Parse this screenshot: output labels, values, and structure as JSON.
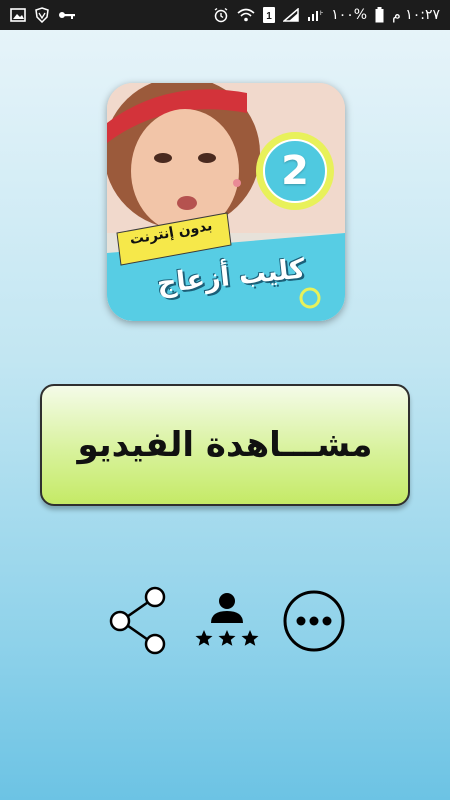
{
  "status_bar": {
    "time": "١٠:٢٧ م",
    "battery_percent": "١٠٠%",
    "icons": [
      "alarm-icon",
      "wifi-icon",
      "sim-1-icon",
      "signal-icon",
      "signal-h-icon",
      "battery-icon",
      "image-icon",
      "vpn-shield-icon",
      "key-icon"
    ]
  },
  "banner": {
    "badge_number": "2",
    "title_text": "كليب أزعاج",
    "ribbon_text": "بدون إنترنت",
    "colors": {
      "badge_fill": "#4fc9e0",
      "badge_ring": "#e8f15a",
      "title_bar": "#57cde4",
      "ribbon": "#f6e84a"
    }
  },
  "primary_button": {
    "label": "مشـــاهدة الفيديو"
  },
  "actions": {
    "share": "share-icon",
    "rate": "rate-stars-icon",
    "more": "more-options-icon"
  }
}
